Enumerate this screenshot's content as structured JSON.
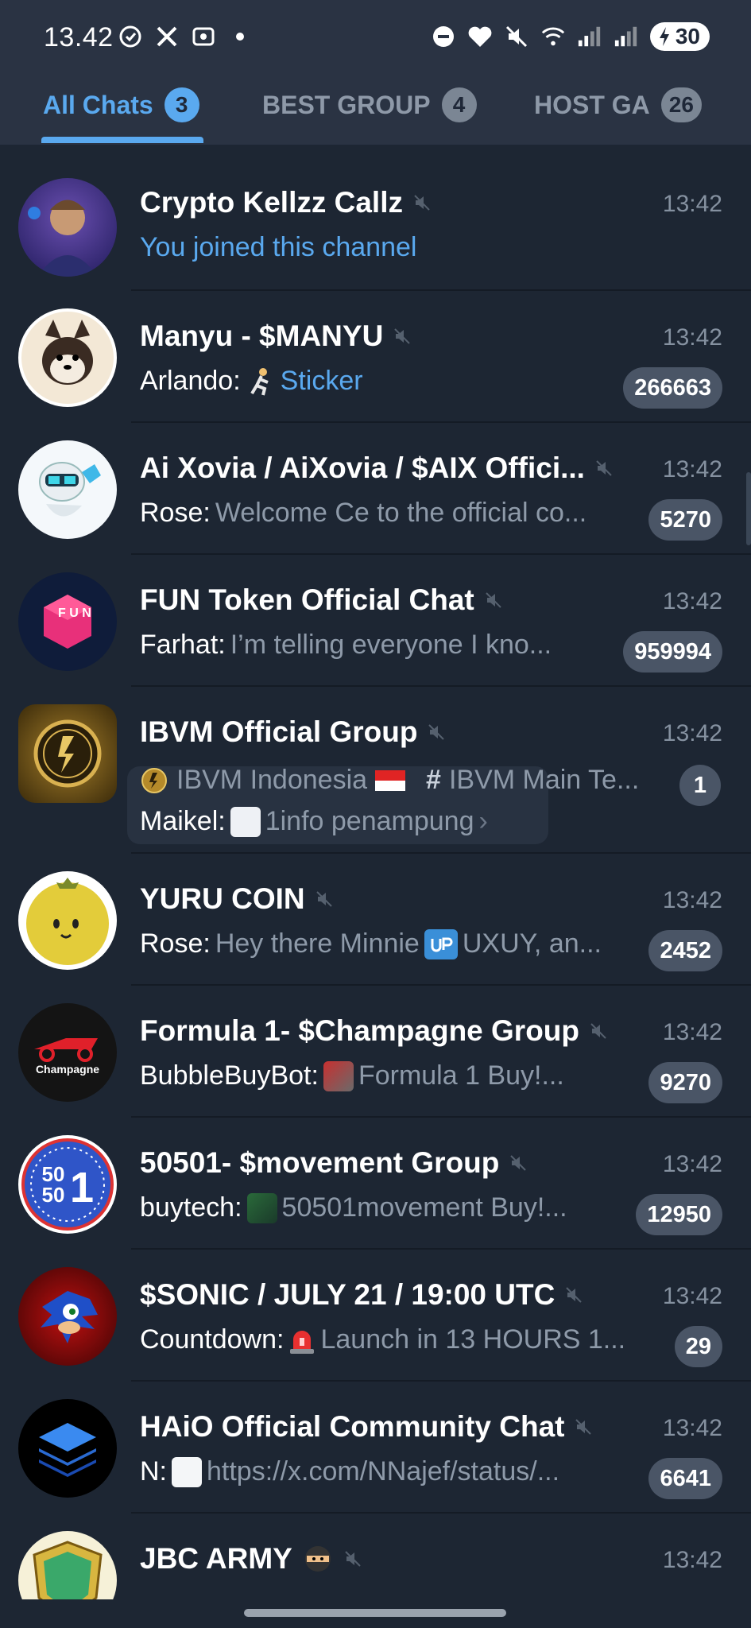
{
  "status_bar": {
    "time": "13.42",
    "battery": "30"
  },
  "tabs": [
    {
      "label": "All Chats",
      "badge": "3"
    },
    {
      "label": "BEST GROUP",
      "badge": "4"
    },
    {
      "label": "HOST GA",
      "badge": "26"
    }
  ],
  "chats": [
    {
      "title": "Crypto Kellzz Callz",
      "time": "13:42",
      "preview": "You joined this channel"
    },
    {
      "title": "Manyu - $MANYU",
      "time": "13:42",
      "sender": "Arlando:",
      "preview": "Sticker",
      "count": "266663"
    },
    {
      "title": "Ai Xovia / AiXovia / $AIX Offici...",
      "time": "13:42",
      "sender": "Rose:",
      "preview": "Welcome Ce to the official co...",
      "count": "5270"
    },
    {
      "title": "FUN Token Official Chat",
      "time": "13:42",
      "sender": "Farhat:",
      "preview": "I’m telling everyone I kno...",
      "count": "959994"
    },
    {
      "title": "IBVM Official Group",
      "time": "13:42",
      "topic1": "IBVM Indonesia",
      "topic2": "IBVM Main Te...",
      "sender": "Maikel:",
      "preview": "1info penampung",
      "count": "1"
    },
    {
      "title": "YURU COIN",
      "time": "13:42",
      "sender": "Rose:",
      "preview_a": "Hey there Minnie",
      "preview_b": "UXUY, an...",
      "count": "2452"
    },
    {
      "title": "Formula 1- $Champagne Group",
      "time": "13:42",
      "sender": "BubbleBuyBot:",
      "preview": "Formula 1 Buy!...",
      "count": "9270"
    },
    {
      "title": "50501- $movement Group",
      "time": "13:42",
      "sender": "buytech:",
      "preview": "50501movement Buy!...",
      "count": "12950"
    },
    {
      "title": "$SONIC / JULY 21 / 19:00 UTC",
      "time": "13:42",
      "sender": "Countdown:",
      "preview": "Launch in 13 HOURS 1...",
      "count": "29"
    },
    {
      "title": "HAiO Official Community Chat",
      "time": "13:42",
      "sender": "N:",
      "preview": "https://x.com/NNajef/status/...",
      "count": "6641"
    },
    {
      "title": "JBC ARMY",
      "time": "13:42"
    }
  ],
  "avatar_labels": {
    "fun": "F U N",
    "formula": "Champagne",
    "movement_top": "50",
    "movement_mid": "50",
    "movement_big": "1"
  },
  "colors": {
    "background": "#1d2633",
    "header": "#2a3343",
    "accent": "#5aa9ef",
    "badge": "#4a5566"
  }
}
